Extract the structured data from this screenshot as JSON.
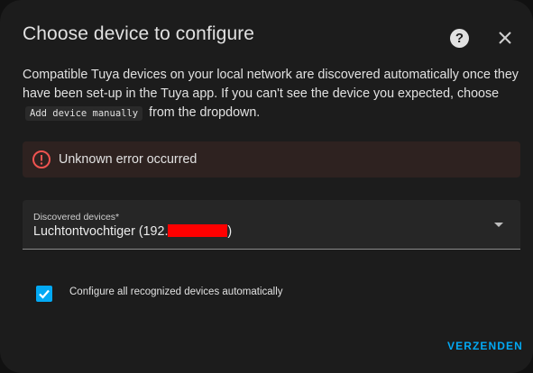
{
  "dialog": {
    "title": "Choose device to configure",
    "help_icon": "help-circle-icon",
    "close_icon": "close-icon"
  },
  "description": {
    "part1": "Compatible Tuya devices on your local network are discovered automatically once they have been set-up in the Tuya app. If you can't see the device you expected, choose",
    "code": "Add device manually",
    "part2": "from the dropdown."
  },
  "alert": {
    "icon": "alert-circle-icon",
    "message": "Unknown error occurred",
    "color": "#ef5350"
  },
  "discovered_devices": {
    "label": "Discovered devices*",
    "value_prefix": "Luchtontvochtiger (192.",
    "value_suffix": ")"
  },
  "auto_configure": {
    "label": "Configure all recognized devices automatically",
    "checked": true
  },
  "actions": {
    "submit_label": "VERZENDEN"
  },
  "colors": {
    "accent": "#03a9f4",
    "background": "#1c1c1c",
    "alert_bg": "#2e2220",
    "redaction": "#ff0000"
  }
}
